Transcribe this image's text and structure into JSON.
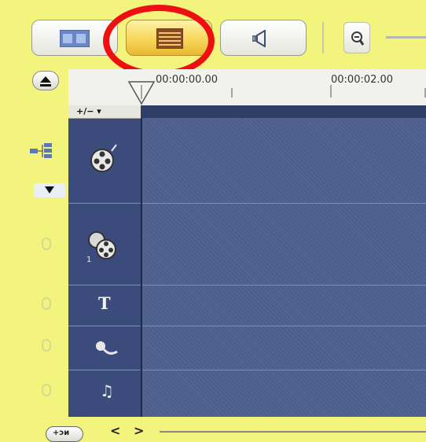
{
  "toolbar": {
    "view_buttons": [
      {
        "name": "storyboard-view-button",
        "icon": "filmstrip-icon",
        "active": false
      },
      {
        "name": "timeline-view-button",
        "icon": "timeline-lines-icon",
        "active": true
      },
      {
        "name": "audio-view-button",
        "icon": "speaker-icon",
        "active": false
      }
    ],
    "zoom_icon": "zoom-out-icon",
    "highlight_color": "#ee0f12"
  },
  "ruler": {
    "time_start": "00:00:00.00",
    "time_next": "00:00:02.00"
  },
  "timeline": {
    "add_remove_label": "+/− ▾",
    "tracks": [
      {
        "name": "video-track",
        "icon": "film-reel-icon"
      },
      {
        "name": "overlay-track",
        "icon": "overlay-reels-icon"
      },
      {
        "name": "title-track",
        "icon": "title-icon",
        "label": "T"
      },
      {
        "name": "voice-track",
        "icon": "microphone-icon"
      },
      {
        "name": "music-track",
        "icon": "music-note-icon",
        "label": "♫"
      }
    ]
  },
  "bottom": {
    "project_button": "+ↄᴎ",
    "prev": "<",
    "next": ">"
  },
  "colors": {
    "background": "#f3f47e",
    "track_bg": "#4d5f8c",
    "header_bg": "#3b4c7c"
  }
}
